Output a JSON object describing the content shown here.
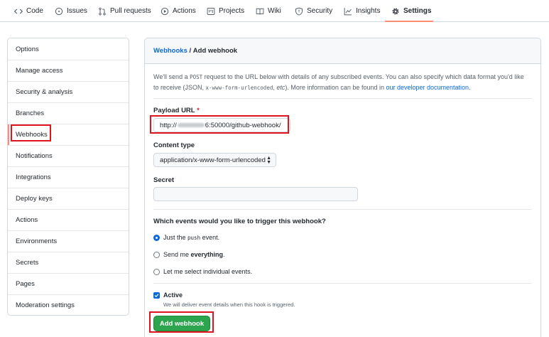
{
  "nav": {
    "tabs": [
      {
        "label": "Code",
        "icon": "code-icon"
      },
      {
        "label": "Issues",
        "icon": "issue-opened-icon"
      },
      {
        "label": "Pull requests",
        "icon": "git-pull-request-icon"
      },
      {
        "label": "Actions",
        "icon": "play-icon"
      },
      {
        "label": "Projects",
        "icon": "project-icon"
      },
      {
        "label": "Wiki",
        "icon": "book-icon"
      },
      {
        "label": "Security",
        "icon": "shield-icon"
      },
      {
        "label": "Insights",
        "icon": "graph-icon"
      },
      {
        "label": "Settings",
        "icon": "gear-icon"
      }
    ],
    "active": "Settings"
  },
  "sidebar": {
    "items": [
      {
        "label": "Options"
      },
      {
        "label": "Manage access"
      },
      {
        "label": "Security & analysis"
      },
      {
        "label": "Branches"
      },
      {
        "label": "Webhooks"
      },
      {
        "label": "Notifications"
      },
      {
        "label": "Integrations"
      },
      {
        "label": "Deploy keys"
      },
      {
        "label": "Actions"
      },
      {
        "label": "Environments"
      },
      {
        "label": "Secrets"
      },
      {
        "label": "Pages"
      },
      {
        "label": "Moderation settings"
      }
    ],
    "selected": "Webhooks"
  },
  "panel": {
    "breadcrumb_link": "Webhooks",
    "breadcrumb_sep": " / ",
    "breadcrumb_current": "Add webhook",
    "intro": {
      "p1": "We'll send a ",
      "post": "POST",
      "p2": " request to the URL below with details of any subscribed events. You can also specify which data format you'd like to receive (JSON, ",
      "form": "x-www-form-urlencoded",
      "p3": ", ",
      "etc": "etc",
      "p4": "). More information can be found in ",
      "doc_link": "our developer documentation",
      "p5": "."
    },
    "payload": {
      "label": "Payload URL",
      "required_mark": "*",
      "value_prefix": "http://",
      "value_suffix": "6:50000/github-webhook/"
    },
    "content_type": {
      "label": "Content type",
      "selected": "application/x-www-form-urlencoded"
    },
    "secret": {
      "label": "Secret",
      "value": ""
    },
    "events": {
      "question": "Which events would you like to trigger this webhook?",
      "options": [
        {
          "pre": "Just the ",
          "code": "push",
          "post": " event.",
          "selected": true
        },
        {
          "pre": "Send me ",
          "strong": "everything",
          "post": ".",
          "selected": false
        },
        {
          "pre": "Let me select individual events.",
          "selected": false
        }
      ]
    },
    "active": {
      "label": "Active",
      "checked": true,
      "note": "We will deliver event details when this hook is triggered."
    },
    "submit_label": "Add webhook"
  },
  "colors": {
    "accent": "#0969da",
    "primary_button": "#2da44e",
    "annotation": "#e0141e",
    "selected_tab": "#fd8c73"
  }
}
